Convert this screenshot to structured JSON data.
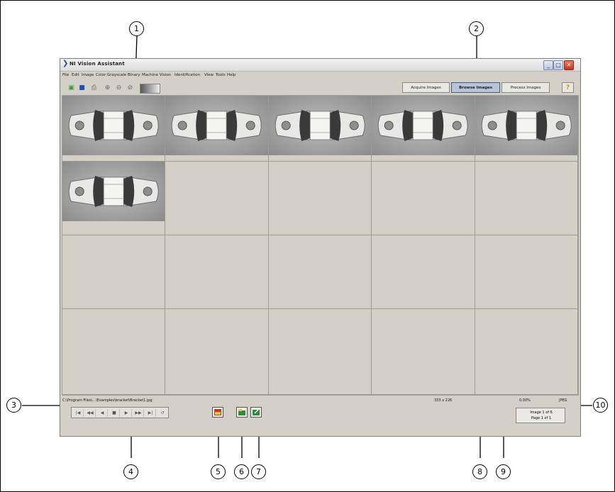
{
  "callouts": [
    "1",
    "2",
    "3",
    "4",
    "5",
    "6",
    "7",
    "8",
    "9",
    "10"
  ],
  "window": {
    "title": "NI Vision Assistant",
    "controls": {
      "minimize": "_",
      "maximize": "□",
      "close": "✕"
    }
  },
  "menu": [
    "File",
    "Edit",
    "Image",
    "Color",
    "Grayscale",
    "Binary",
    "Machine Vision",
    "Identification",
    "View",
    "Tools",
    "Help"
  ],
  "toolbar": {
    "icons": [
      "open-image-icon",
      "save-image-icon",
      "print-icon",
      "zoom-in-icon",
      "zoom-out-icon",
      "zoom-fit-icon",
      "palette-icon"
    ],
    "modes": [
      "Acquire Images",
      "Browse Images",
      "Process Images"
    ],
    "active_mode": "Browse Images",
    "help_icon": "?"
  },
  "browser": {
    "columns": 5,
    "rows": 4,
    "thumbnails": 6,
    "selected_index": 0
  },
  "status": {
    "path": "C:\\Program Files\\...\\Examples\\bracket\\Bracket1.jpg",
    "image_size": "333 x 226",
    "zoom": "0.00%",
    "image_type": "JPEG",
    "page_info": {
      "image": "Image 1 of 6",
      "page": "Page 1 of 1"
    }
  },
  "navigation": {
    "buttons": [
      "|◀",
      "◀◀",
      "◀",
      "■",
      "▶",
      "▶▶",
      "▶|",
      "↺"
    ]
  },
  "actions": [
    "image-info-button",
    "open-folder-button",
    "export-button"
  ],
  "colors": {
    "selected_mode": "#b7c3d8",
    "window_bg": "#d4d0c8"
  }
}
